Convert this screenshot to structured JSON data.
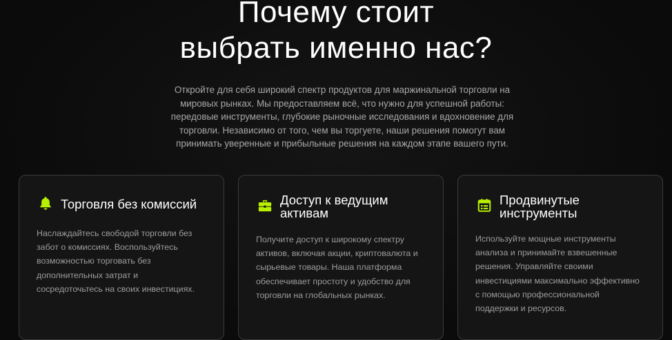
{
  "section": {
    "title_lines": [
      "Почему стоит",
      "выбрать именно нас?"
    ],
    "intro_lines": [
      "Откройте для себя широкий спектр продуктов для маржинальной торговли на",
      "мировых рынках. Мы предоставляем всё, что нужно для успешной работы:",
      "передовые инструменты, глубокие рыночные исследования и вдохновение для",
      "торговли. Независимо от того, чем вы торгуете, наши решения помогут вам",
      "принимать уверенные и прибыльные решения на каждом этапе вашего пути."
    ]
  },
  "colors": {
    "accent": "#b7f000",
    "background": "#0b0b0b",
    "card_background": "#151515",
    "card_border": "#3a3a3a"
  },
  "cards": [
    {
      "icon": "bell-icon",
      "title_lines": [
        "Торговля без комиссий"
      ],
      "text_lines": [
        "Наслаждайтесь свободой торговли без",
        "забот о комиссиях. Воспользуйтесь",
        "возможностью торговать без",
        "дополнительных затрат и",
        "сосредоточьтесь на своих инвестициях."
      ]
    },
    {
      "icon": "briefcase-icon",
      "title_lines": [
        "Доступ к ведущим",
        "активам"
      ],
      "text_lines": [
        "Получите доступ к широкому спектру",
        "активов, включая акции, криптовалюта и",
        "сырьевые товары. Наша платформа",
        "обеспечивает простоту и удобство для",
        "торговли на глобальных рынках."
      ]
    },
    {
      "icon": "calendar-icon",
      "title_lines": [
        "Продвинутые",
        "инструменты"
      ],
      "text_lines": [
        "Используйте мощные инструменты",
        "анализа и принимайте взвешенные",
        "решения. Управляйте своими",
        "инвестициями максимально эффективно",
        "с помощью профессиональной",
        "поддержки и ресурсов."
      ]
    }
  ]
}
